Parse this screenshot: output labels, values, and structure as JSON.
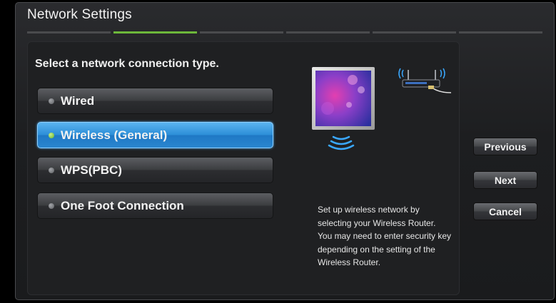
{
  "window": {
    "title": "Network Settings",
    "steps": [
      false,
      true,
      false,
      false,
      false,
      false
    ]
  },
  "panel": {
    "prompt": "Select a network connection type.",
    "options": [
      {
        "label": "Wired",
        "selected": false
      },
      {
        "label": "Wireless (General)",
        "selected": true
      },
      {
        "label": "WPS(PBC)",
        "selected": false
      },
      {
        "label": "One Foot Connection",
        "selected": false
      }
    ],
    "help_lines": [
      "Set up wireless network by",
      "selecting your Wireless Router.",
      "You may need to enter security key",
      "depending on the setting of the",
      "Wireless Router."
    ],
    "illustration_icons": [
      "tv-icon",
      "wifi-waves-icon",
      "router-icon"
    ]
  },
  "buttons": {
    "previous": "Previous",
    "next": "Next",
    "cancel": "Cancel"
  },
  "colors": {
    "accent_step": "#6db83a",
    "selected_blue": "#2d8fd8",
    "selected_dot": "#62b22c"
  }
}
